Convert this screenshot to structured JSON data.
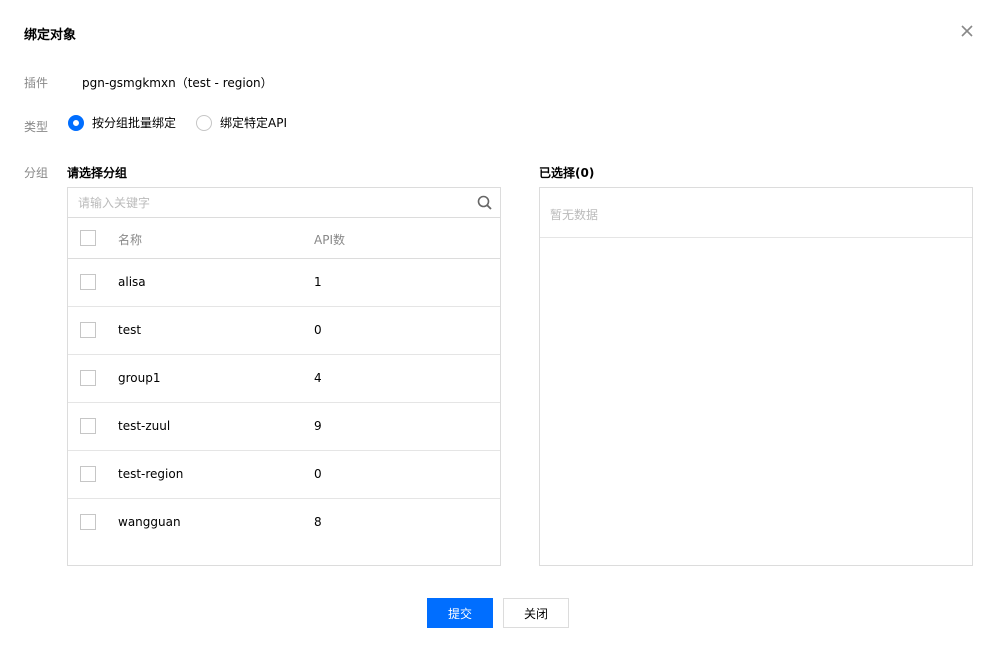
{
  "dialog": {
    "title": "绑定对象"
  },
  "plugin": {
    "label": "插件",
    "value": "pgn-gsmgkmxn（test - region）"
  },
  "type": {
    "label": "类型",
    "options": [
      {
        "label": "按分组批量绑定",
        "checked": true
      },
      {
        "label": "绑定特定API",
        "checked": false
      }
    ]
  },
  "group": {
    "label": "分组",
    "left_title": "请选择分组",
    "right_title": "已选择(0)",
    "search_placeholder": "请输入关键字",
    "columns": {
      "name": "名称",
      "api": "API数"
    },
    "rows": [
      {
        "name": "alisa",
        "api": "1"
      },
      {
        "name": "test",
        "api": "0"
      },
      {
        "name": "group1",
        "api": "4"
      },
      {
        "name": "test-zuul",
        "api": "9"
      },
      {
        "name": "test-region",
        "api": "0"
      },
      {
        "name": "wangguan",
        "api": "8"
      }
    ],
    "empty_text": "暂无数据"
  },
  "footer": {
    "submit_label": "提交",
    "close_label": "关闭"
  },
  "colors": {
    "accent": "#006eff",
    "border": "#dcdcdc",
    "muted_text": "#888888"
  }
}
